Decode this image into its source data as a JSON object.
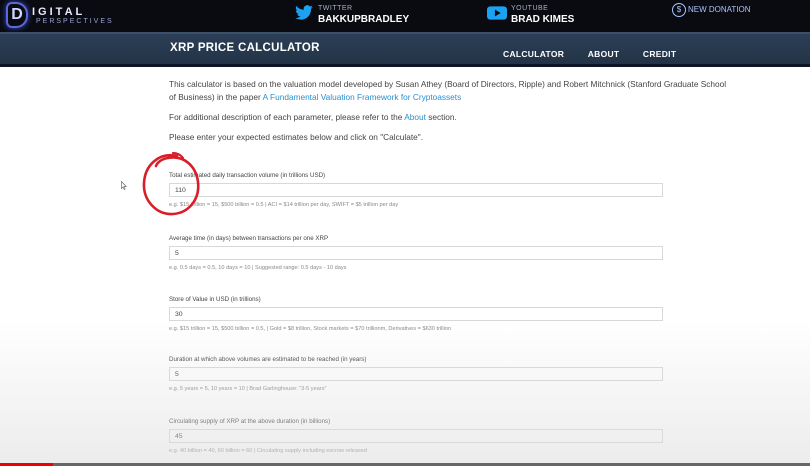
{
  "banner": {
    "logo_letter": "D",
    "logo_line1": "IGITAL",
    "logo_line2": "PERSPECTIVES",
    "twitter_label": "TWITTER",
    "twitter_handle": "BAKKUPBRADLEY",
    "youtube_label": "YOUTUBE",
    "youtube_name": "BRAD KIMES",
    "donation_label": "NEW DONATION",
    "donation_icon": "$"
  },
  "nav": {
    "title": "XRP PRICE CALCULATOR",
    "links": [
      "CALCULATOR",
      "ABOUT",
      "CREDIT"
    ]
  },
  "intro": {
    "p1_text": "This calculator is based on the valuation model developed by Susan Athey (Board of Directors, Ripple) and Robert Mitchnick (Stanford Graduate School of Business) in the paper ",
    "p1_link": "A Fundamental Valuation Framework for Cryptoassets",
    "p2_before": "For additional description of each parameter, please refer to the ",
    "p2_link": "About",
    "p2_after": " section.",
    "p3_text": "Please enter your expected estimates below and click on \"Calculate\"."
  },
  "fields": [
    {
      "label": "Total estimated daily transaction volume (in trillions USD)",
      "value": "110",
      "hint": "e.g. $15 trillion = 15, $500 billion = 0.5 | ACI = $14 trillion per day, SWIFT = $5 trillion per day"
    },
    {
      "label": "Average time (in days) between transactions per one XRP",
      "value": "5",
      "hint": "e.g. 0.5 days = 0.5, 10 days = 10 | Suggested range: 0.5 days - 10 days"
    },
    {
      "label": "Store of Value in USD (in trillions)",
      "value": "30",
      "hint": "e.g. $15 trillion = 15, $500 billion = 0.5, | Gold = $8 trillion, Stock markets = $70 trillionm, Derivatives = $630 trillion"
    },
    {
      "label": "Duration at which above volumes are estimated to be reached (in years)",
      "value": "5",
      "hint": "e.g. 5 years = 5, 10 years = 10 | Brad Garlinghouse: \"3-5 years\""
    },
    {
      "label": "Circulating supply of XRP at the above duration (in billions)",
      "value": "45",
      "hint": "e.g. 40 billion = 40, 60 billion = 60 | Circulating supply including escrow released"
    }
  ],
  "video_progress": 0.065,
  "colors": {
    "accent_link": "#2a8fd0",
    "nav_bg": "#2c3f57",
    "annotation": "#d81e2a",
    "progress": "#ee0000"
  }
}
